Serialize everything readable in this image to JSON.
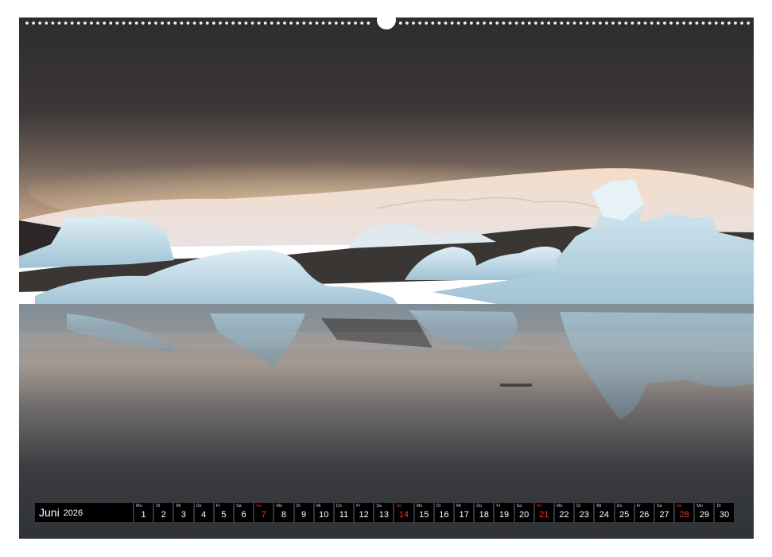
{
  "calendar": {
    "month": "Juni",
    "year": "2026",
    "colors": {
      "background": "#000000",
      "text": "#ffffff",
      "sunday": "#e83535"
    },
    "days": [
      {
        "wd": "Mo",
        "d": "1",
        "sun": false
      },
      {
        "wd": "Di",
        "d": "2",
        "sun": false
      },
      {
        "wd": "Mi",
        "d": "3",
        "sun": false
      },
      {
        "wd": "Do",
        "d": "4",
        "sun": false
      },
      {
        "wd": "Fr",
        "d": "5",
        "sun": false
      },
      {
        "wd": "Sa",
        "d": "6",
        "sun": false
      },
      {
        "wd": "So",
        "d": "7",
        "sun": true
      },
      {
        "wd": "Mo",
        "d": "8",
        "sun": false
      },
      {
        "wd": "Di",
        "d": "9",
        "sun": false
      },
      {
        "wd": "Mi",
        "d": "10",
        "sun": false
      },
      {
        "wd": "Do",
        "d": "11",
        "sun": false
      },
      {
        "wd": "Fr",
        "d": "12",
        "sun": false
      },
      {
        "wd": "Sa",
        "d": "13",
        "sun": false
      },
      {
        "wd": "So",
        "d": "14",
        "sun": true
      },
      {
        "wd": "Mo",
        "d": "15",
        "sun": false
      },
      {
        "wd": "Di",
        "d": "16",
        "sun": false
      },
      {
        "wd": "Mi",
        "d": "17",
        "sun": false
      },
      {
        "wd": "Do",
        "d": "18",
        "sun": false
      },
      {
        "wd": "Fr",
        "d": "19",
        "sun": false
      },
      {
        "wd": "Sa",
        "d": "20",
        "sun": false
      },
      {
        "wd": "So",
        "d": "21",
        "sun": true
      },
      {
        "wd": "Mo",
        "d": "22",
        "sun": false
      },
      {
        "wd": "Di",
        "d": "23",
        "sun": false
      },
      {
        "wd": "Mi",
        "d": "24",
        "sun": false
      },
      {
        "wd": "Do",
        "d": "25",
        "sun": false
      },
      {
        "wd": "Fr",
        "d": "26",
        "sun": false
      },
      {
        "wd": "Sa",
        "d": "27",
        "sun": false
      },
      {
        "wd": "So",
        "d": "28",
        "sun": true
      },
      {
        "wd": "Mo",
        "d": "29",
        "sun": false
      },
      {
        "wd": "Di",
        "d": "30",
        "sun": false
      }
    ]
  },
  "photo": {
    "subject": "icebergs in glacier lagoon with reflections",
    "colors": {
      "sky_dark": "#2e2c2e",
      "glow": "#c8a78a",
      "ice": "#bcd8e6",
      "water": "#2f3236"
    }
  }
}
